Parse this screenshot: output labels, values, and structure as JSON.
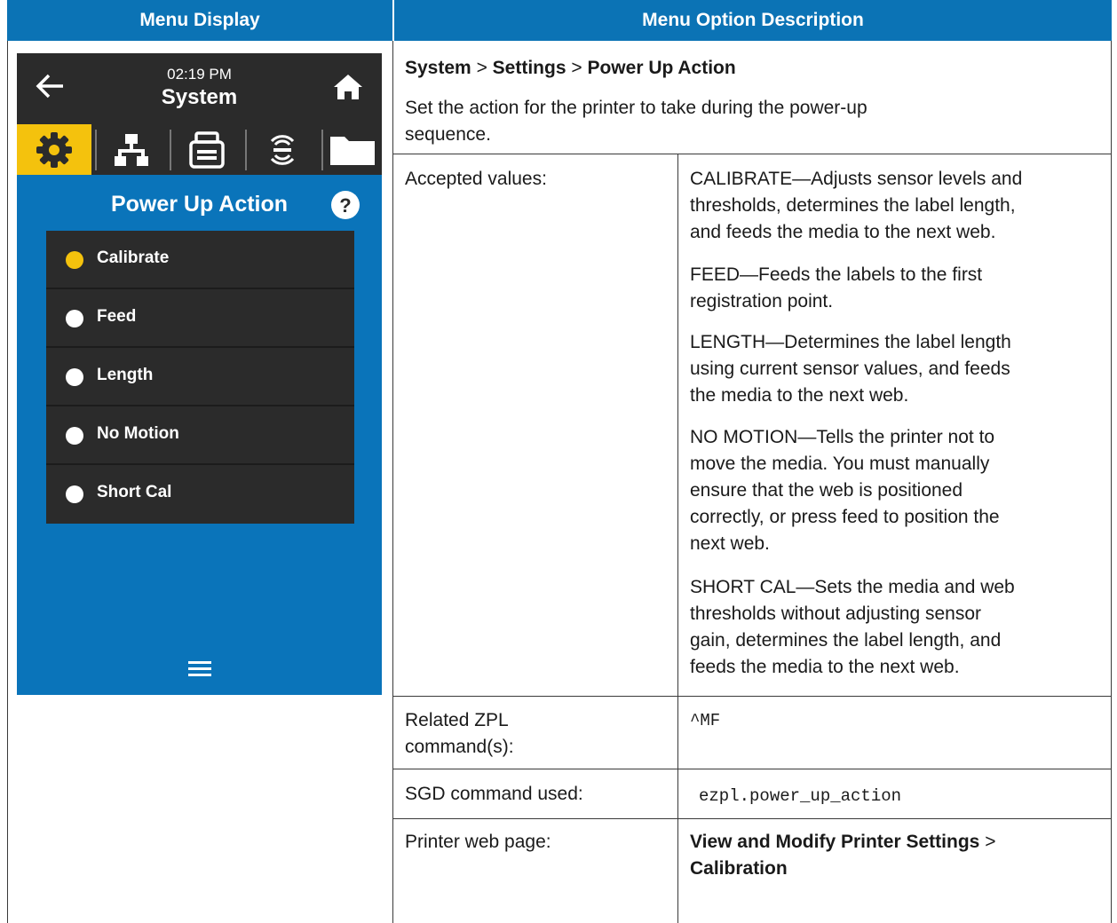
{
  "headers": {
    "menu_display": "Menu Display",
    "menu_option_description": "Menu Option Description"
  },
  "device": {
    "time": "02:19 PM",
    "title": "System",
    "tabs": [
      "settings-gear-icon",
      "network-icon",
      "printer-icon",
      "rfid-icon",
      "folder-icon"
    ],
    "selected_tab": 0,
    "panel_title": "Power Up Action",
    "options": [
      {
        "label": "Calibrate",
        "selected": true
      },
      {
        "label": "Feed",
        "selected": false
      },
      {
        "label": "Length",
        "selected": false
      },
      {
        "label": "No Motion",
        "selected": false
      },
      {
        "label": "Short Cal",
        "selected": false
      }
    ],
    "accent_color": "#f4c20d",
    "screen_color": "#0a74ba"
  },
  "description": {
    "path": {
      "system": "System",
      "sep": ">",
      "settings": "Settings",
      "power_up_action": "Power Up Action"
    },
    "intro_line1": "Set the action for the printer to take during the power-up",
    "intro_line2": "sequence.",
    "accepted_values_label": "Accepted values:",
    "values": {
      "calibrate": [
        "CALIBRATE—Adjusts sensor levels and",
        "thresholds, determines the label length,",
        "and feeds the media to the next web."
      ],
      "feed": [
        "FEED—Feeds the labels to the first",
        "registration point."
      ],
      "length": [
        "LENGTH—Determines the label length",
        "using current sensor values, and feeds",
        "the media to the next web."
      ],
      "no_motion": [
        "NO MOTION—Tells the printer not to",
        "move the media. You must manually",
        "ensure that the web is positioned",
        "correctly, or press feed to position the",
        "next web."
      ],
      "short_cal": [
        "SHORT CAL—Sets the media and web",
        "thresholds without adjusting sensor",
        "gain, determines the label length, and",
        "feeds the media to the next web."
      ]
    },
    "related_zpl_label": [
      "Related ZPL",
      "command(s):"
    ],
    "related_zpl_value": "^MF",
    "sgd_label": "SGD command used:",
    "sgd_value": "ezpl.power_up_action",
    "web_page_label": "Printer web page:",
    "web_page_value": {
      "part1": "View and Modify Printer Settings",
      "sep": ">",
      "part2": "Calibration"
    }
  }
}
